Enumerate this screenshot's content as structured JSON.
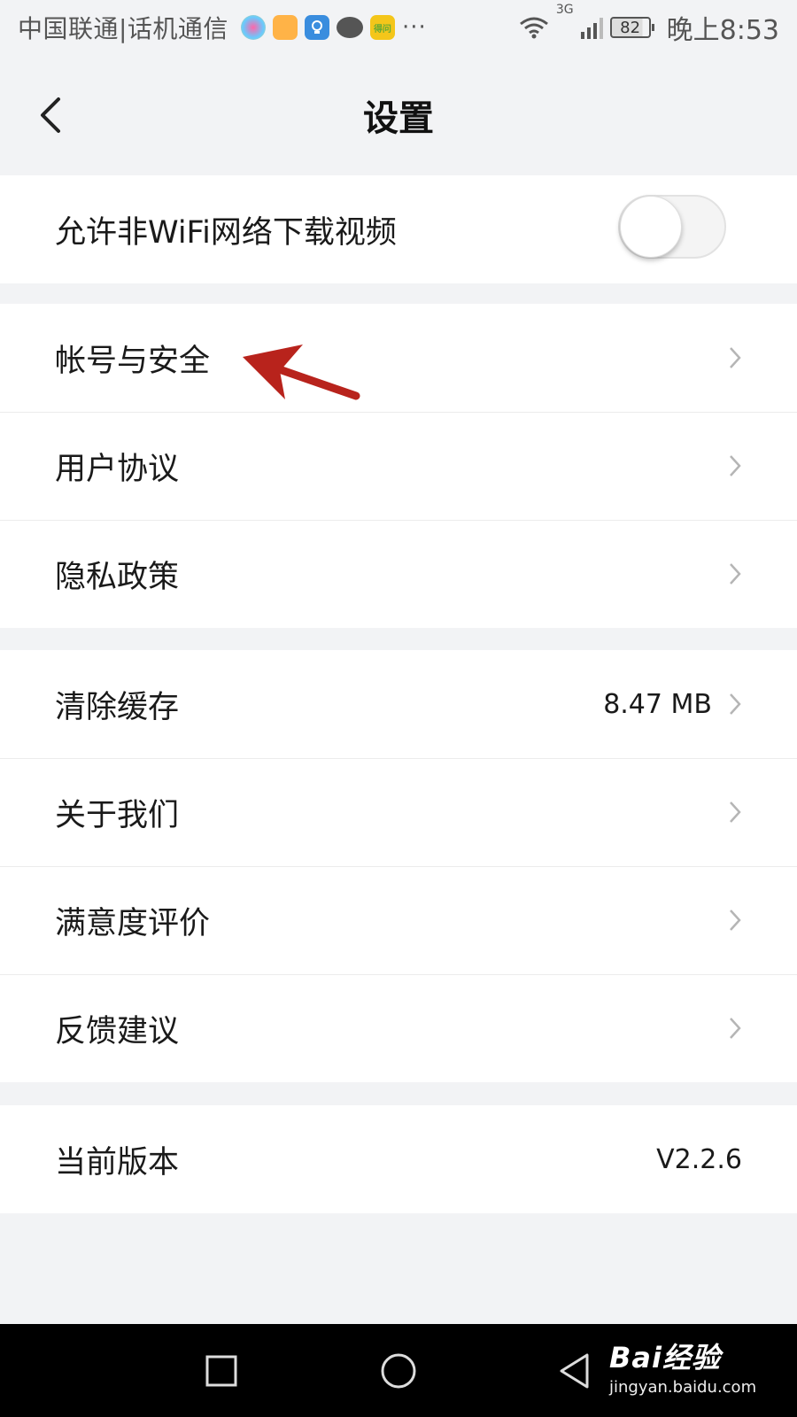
{
  "status_bar": {
    "carrier": "中国联通|话机通信",
    "app_icon_e_text": "得问",
    "more": "···",
    "network": "3G",
    "battery": "82",
    "time": "晚上8:53"
  },
  "header": {
    "title": "设置"
  },
  "groups": {
    "network": {
      "wifi_label": "允许非WiFi网络下载视频",
      "wifi_enabled": false
    },
    "account": [
      {
        "label": "帐号与安全"
      },
      {
        "label": "用户协议"
      },
      {
        "label": "隐私政策"
      }
    ],
    "misc": [
      {
        "label": "清除缓存",
        "value": "8.47 MB"
      },
      {
        "label": "关于我们"
      },
      {
        "label": "满意度评价"
      },
      {
        "label": "反馈建议"
      }
    ],
    "version": {
      "label": "当前版本",
      "value": "V2.2.6"
    }
  },
  "watermark": {
    "logo": "Bai经验",
    "url": "jingyan.baidu.com"
  },
  "colors": {
    "background": "#f2f3f5",
    "annotation_arrow": "#b8231c",
    "chevron": "#b5b5b5"
  }
}
